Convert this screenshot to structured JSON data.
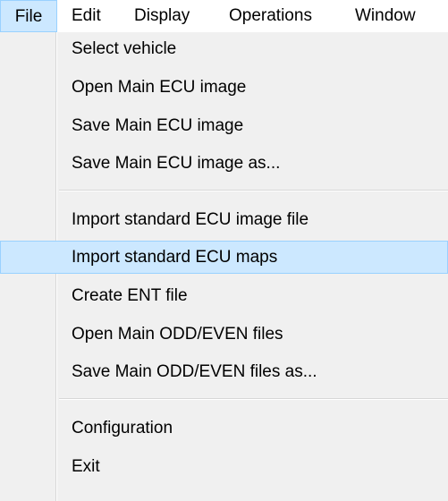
{
  "menubar": {
    "items": [
      {
        "label": "File"
      },
      {
        "label": "Edit"
      },
      {
        "label": "Display"
      },
      {
        "label": "Operations"
      },
      {
        "label": "Window"
      }
    ]
  },
  "file_menu": {
    "items": [
      {
        "label": "Select vehicle"
      },
      {
        "label": "Open Main ECU image"
      },
      {
        "label": "Save Main ECU image"
      },
      {
        "label": "Save Main ECU image as..."
      },
      {
        "label": "Import standard ECU image file"
      },
      {
        "label": "Import standard ECU maps"
      },
      {
        "label": "Create ENT file"
      },
      {
        "label": "Open Main ODD/EVEN files"
      },
      {
        "label": "Save Main ODD/EVEN files as..."
      },
      {
        "label": "Configuration"
      },
      {
        "label": "Exit"
      }
    ],
    "highlighted_item": "Import standard ECU maps"
  },
  "colors": {
    "menu_background": "#f0f0f0",
    "highlight_fill": "#cce8ff",
    "highlight_border": "#99d1ff"
  }
}
